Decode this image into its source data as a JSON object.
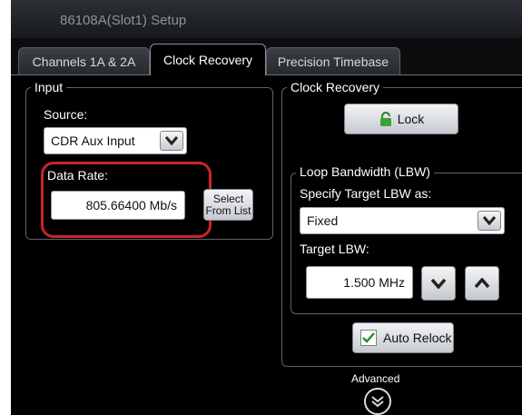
{
  "window": {
    "title": "86108A(Slot1) Setup"
  },
  "tabs": [
    {
      "label": "Channels 1A & 2A"
    },
    {
      "label": "Clock Recovery"
    },
    {
      "label": "Precision Timebase"
    }
  ],
  "input": {
    "legend": "Input",
    "source_label": "Source:",
    "source_value": "CDR Aux Input",
    "data_rate_label": "Data Rate:",
    "data_rate_value": "805.66400 Mb/s",
    "select_button_line1": "Select",
    "select_button_line2": "From List"
  },
  "clock_recovery": {
    "legend": "Clock Recovery",
    "lock_button": "Lock",
    "loop_bandwidth_legend": "Loop Bandwidth (LBW)",
    "specify_label": "Specify Target LBW as:",
    "specify_value": "Fixed",
    "target_lbw_label": "Target LBW:",
    "target_lbw_value": "1.500 MHz",
    "auto_relock_label": "Auto Relock",
    "auto_relock_checked": true
  },
  "advanced": {
    "label": "Advanced"
  },
  "colors": {
    "highlight": "#c8262b",
    "lock_icon": "#3aa13a",
    "check": "#2f8f2f"
  }
}
